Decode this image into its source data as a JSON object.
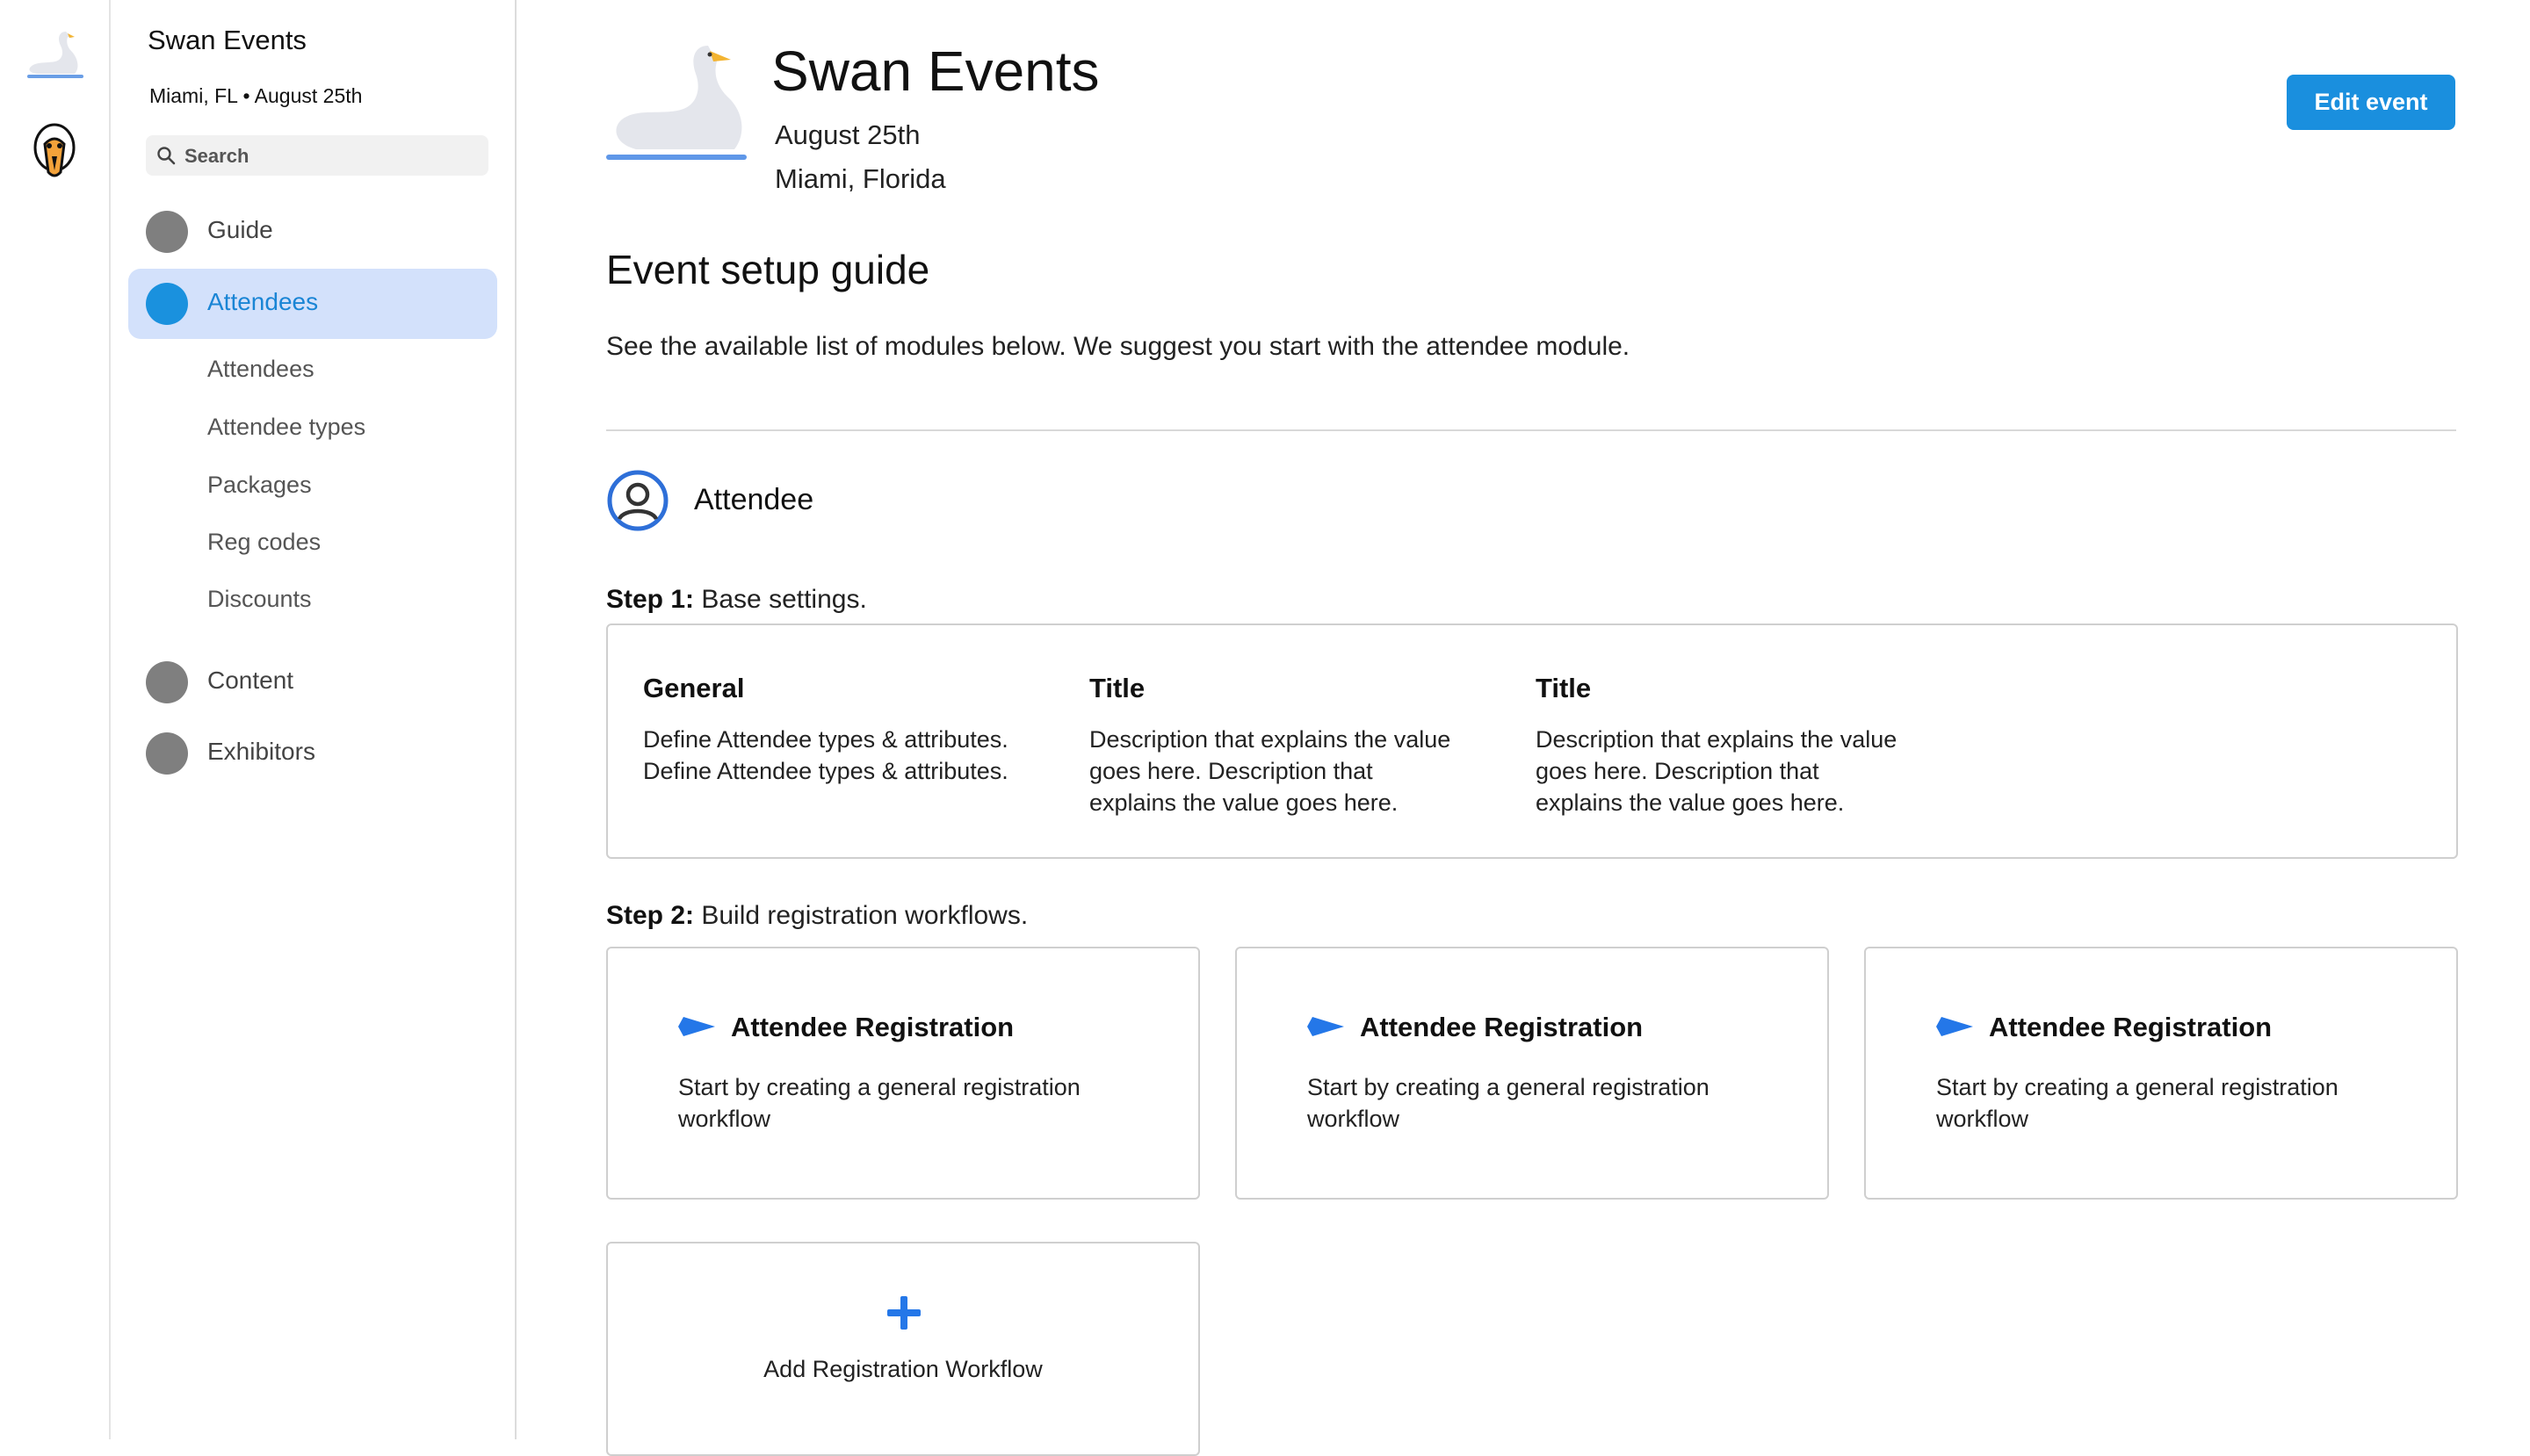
{
  "sidebar": {
    "title": "Swan Events",
    "subtitle": "Miami, FL • August 25th",
    "search_placeholder": "Search",
    "nav": [
      {
        "label": "Guide",
        "active": false
      },
      {
        "label": "Attendees",
        "active": true
      },
      {
        "label": "Content",
        "active": false
      },
      {
        "label": "Exhibitors",
        "active": false
      }
    ],
    "sub_items": [
      "Attendees",
      "Attendee types",
      "Packages",
      "Reg codes",
      "Discounts"
    ]
  },
  "header": {
    "title": "Swan Events",
    "date": "August 25th",
    "location": "Miami, Florida",
    "edit_button": "Edit event"
  },
  "guide": {
    "title": "Event setup guide",
    "description": "See the available list of modules below. We suggest you start with the attendee module."
  },
  "module": {
    "label": "Attendee",
    "step1": {
      "prefix": "Step 1:",
      "text": " Base settings."
    },
    "base_settings": [
      {
        "title": "General",
        "description": "Define Attendee types & attributes. Define Attendee types & attributes."
      },
      {
        "title": "Title",
        "description": "Description that explains the value goes here. Description that explains the value goes here."
      },
      {
        "title": "Title",
        "description": "Description that explains the value goes here. Description that explains the value goes here."
      }
    ],
    "step2": {
      "prefix": "Step 2:",
      "text": " Build registration workflows."
    },
    "workflows": [
      {
        "title": "Attendee Registration",
        "description": "Start by creating a general registration workflow"
      },
      {
        "title": "Attendee Registration",
        "description": "Start by creating a general registration workflow"
      },
      {
        "title": "Attendee Registration",
        "description": "Start by creating a general registration workflow"
      }
    ],
    "add_workflow": "Add Registration Workflow"
  },
  "colors": {
    "accent": "#1a8fde",
    "active_nav_bg": "#d3e1fb",
    "arrow": "#2477e8",
    "nav_dot": "#7f7f7f"
  },
  "icons": [
    "swan-logo-icon",
    "avatar-icon",
    "search-icon",
    "user-circle-icon",
    "arrow-right-icon",
    "plus-icon"
  ]
}
